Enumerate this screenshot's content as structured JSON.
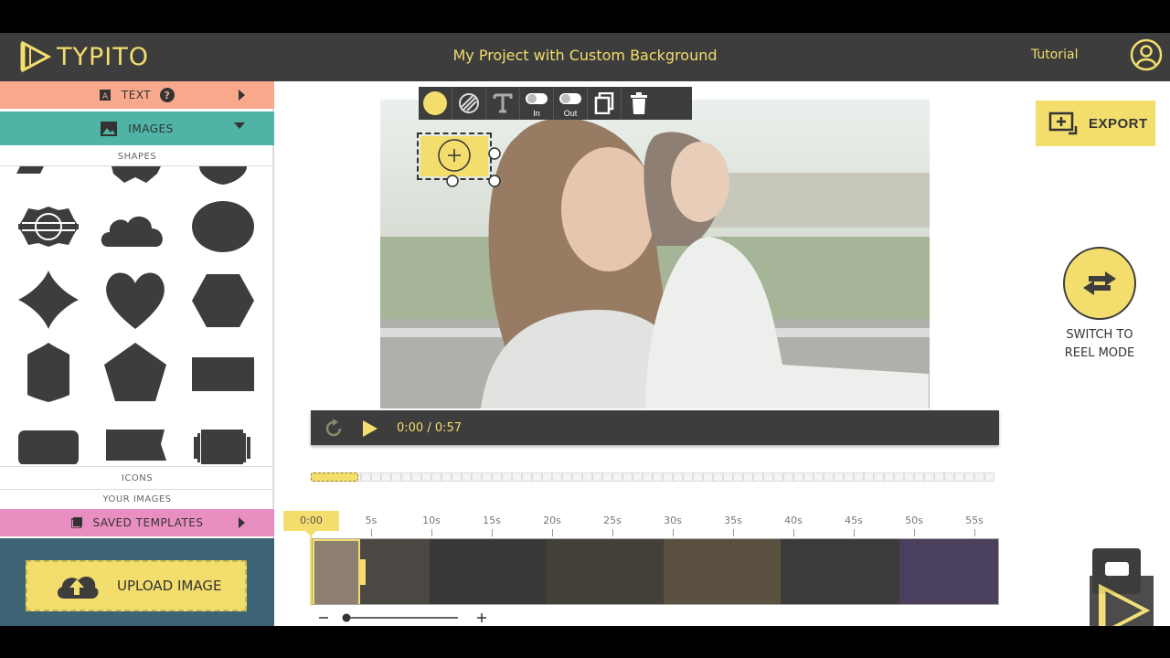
{
  "app": {
    "logo_text": "TYPITO",
    "project_title": "My Project with Custom Background",
    "tutorial_label": "Tutorial"
  },
  "sidebar": {
    "text_label": "TEXT",
    "images_label": "IMAGES",
    "shapes_label": "SHAPES",
    "icons_label": "ICONS",
    "your_images_label": "YOUR IMAGES",
    "saved_templates_label": "SAVED TEMPLATES",
    "upload_label": "UPLOAD IMAGE"
  },
  "toolbar": {
    "in_label": "In",
    "out_label": "Out"
  },
  "player": {
    "current_time": "0:00",
    "separator": "/",
    "duration": "0:57"
  },
  "timeline": {
    "flag_time": "0:00",
    "ticks": [
      "5s",
      "10s",
      "15s",
      "20s",
      "25s",
      "30s",
      "35s",
      "40s",
      "45s",
      "50s",
      "55s"
    ]
  },
  "right_panel": {
    "export_label": "EXPORT",
    "reel_line1": "SWITCH TO",
    "reel_line2": "REEL MODE"
  },
  "colors": {
    "accent": "#f3dd6d",
    "dark": "#3d3d3d",
    "text_tab": "#f9a98b",
    "images_tab": "#4fb3a5",
    "templates_tab": "#e98ec0",
    "upload_bg": "#3c6475"
  },
  "icons": [
    "play-icon",
    "replay-icon",
    "help-icon",
    "upload-icon",
    "export-icon",
    "swap-icon",
    "chat-icon",
    "user-icon",
    "copy-icon",
    "trash-icon",
    "text-tool-icon"
  ]
}
